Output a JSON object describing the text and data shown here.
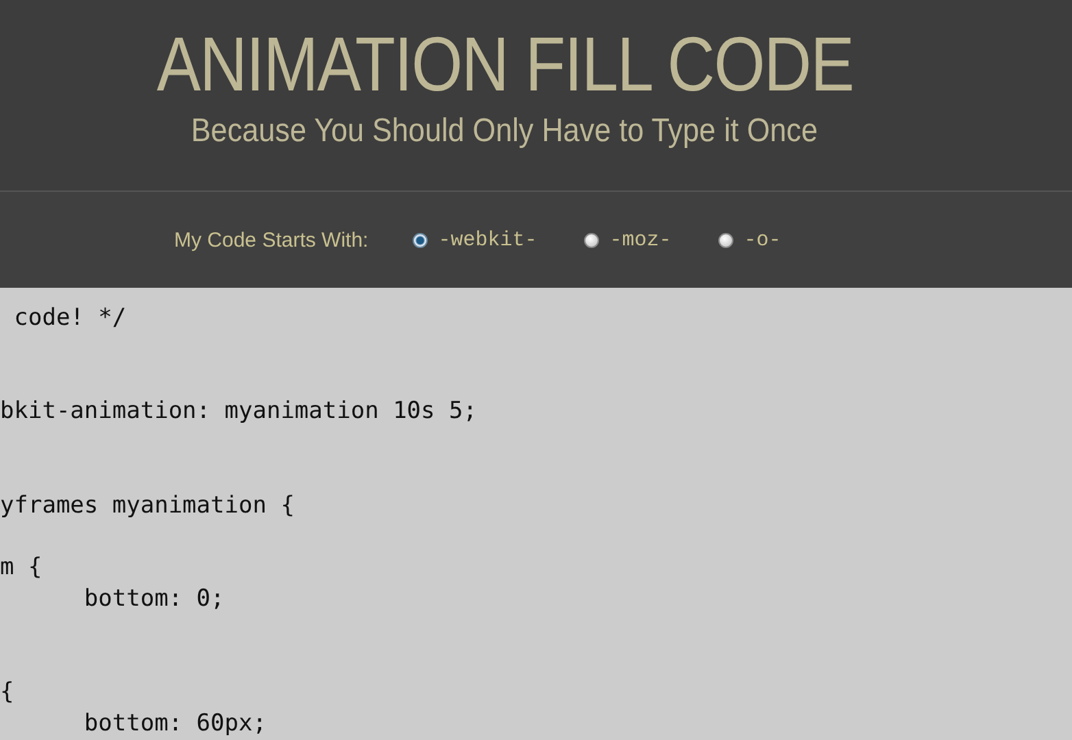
{
  "header": {
    "title": "ANIMATION FILL CODE",
    "subtitle": "Because You Should Only Have to Type it Once"
  },
  "prefix_options": {
    "label": "My Code Starts With:",
    "options": [
      {
        "label": "-webkit-",
        "selected": true
      },
      {
        "label": "-moz-",
        "selected": false
      },
      {
        "label": "-o-",
        "selected": false
      }
    ]
  },
  "code": " code! */\n\n\nbkit-animation: myanimation 10s 5;\n\n\nyframes myanimation {\n\nm {\n      bottom: 0;\n\n\n{\n      bottom: 60px;"
}
